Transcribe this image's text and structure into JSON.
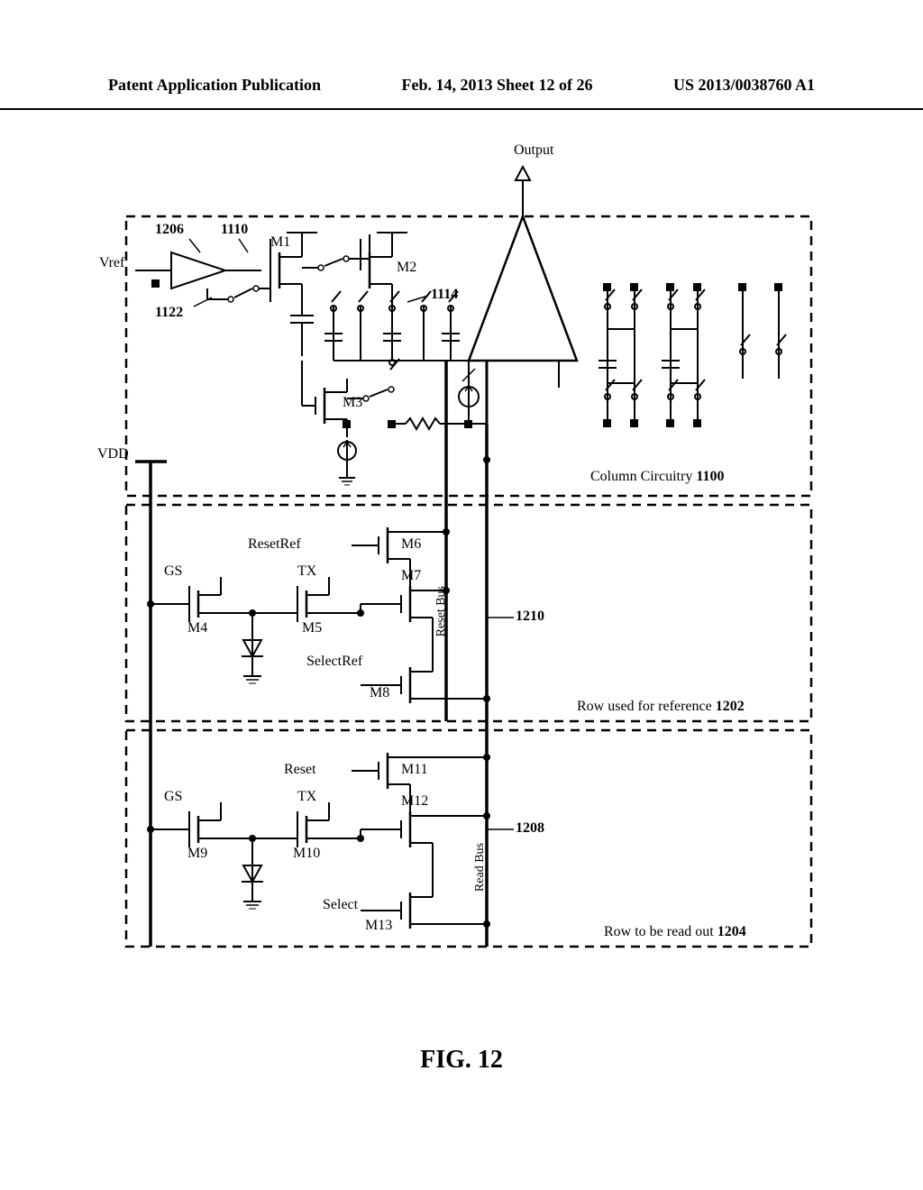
{
  "header": {
    "left": "Patent Application Publication",
    "center": "Feb. 14, 2013  Sheet 12 of 26",
    "right": "US 2013/0038760 A1"
  },
  "figure": {
    "caption": "FIG. 12",
    "output_label": "Output",
    "vref_label": "Vref",
    "vdd_label": "VDD",
    "col_circuitry_label": "Column Circuitry",
    "col_circuitry_num": "1100",
    "row_ref_label": "Row used for reference",
    "row_ref_num": "1202",
    "row_read_label": "Row to be read out",
    "row_read_num": "1204",
    "reset_bus_label": "Reset Bus",
    "read_bus_label": "Read Bus",
    "ref_nums": {
      "n1206": "1206",
      "n1110": "1110",
      "n1122": "1122",
      "n1114": "1114",
      "n1210": "1210",
      "n1208": "1208"
    },
    "transistors": {
      "m1": "M1",
      "m2": "M2",
      "m3": "M3",
      "m4": "M4",
      "m5": "M5",
      "m6": "M6",
      "m7": "M7",
      "m8": "M8",
      "m9": "M9",
      "m10": "M10",
      "m11": "M11",
      "m12": "M12",
      "m13": "M13"
    },
    "signals": {
      "gs1": "GS",
      "gs2": "GS",
      "tx1": "TX",
      "tx2": "TX",
      "reset_ref": "ResetRef",
      "select_ref": "SelectRef",
      "reset": "Reset",
      "select": "Select"
    }
  }
}
